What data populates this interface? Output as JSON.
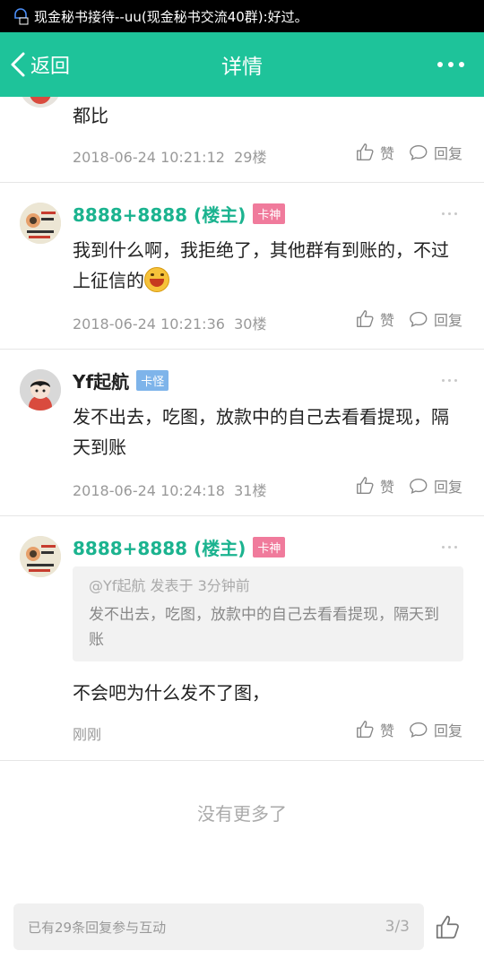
{
  "status_bar": {
    "notification": "现金秘书接待--uu(现金秘书交流40群):好过。"
  },
  "nav": {
    "back_label": "返回",
    "title": "详情"
  },
  "posts": [
    {
      "text": "都比",
      "time": "2018-06-24 10:21:12",
      "floor": "29楼",
      "like_label": "赞",
      "reply_label": "回复"
    },
    {
      "author": "8888+8888 (楼主)",
      "badge": "卡神",
      "text": "我到什么啊，我拒绝了，其他群有到账的，不过上征信的",
      "time": "2018-06-24 10:21:36",
      "floor": "30楼",
      "like_label": "赞",
      "reply_label": "回复"
    },
    {
      "author": "Yf起航",
      "badge": "卡怪",
      "text": "发不出去，吃图，放款中的自己去看看提现，隔天到账",
      "time": "2018-06-24 10:24:18",
      "floor": "31楼",
      "like_label": "赞",
      "reply_label": "回复"
    },
    {
      "author": "8888+8888 (楼主)",
      "badge": "卡神",
      "quote_head": "@Yf起航 发表于 3分钟前",
      "quote_body": "发不出去，吃图，放款中的自己去看看提现，隔天到账",
      "text": "不会吧为什么发不了图，",
      "time": "刚刚",
      "like_label": "赞",
      "reply_label": "回复"
    }
  ],
  "footer_note": "没有更多了",
  "bottom_bar": {
    "placeholder": "已有29条回复参与互动",
    "page": "3/3"
  },
  "colors": {
    "accent": "#1ec39a",
    "author_green": "#1bb38f",
    "badge_pink": "#f07b9c",
    "badge_blue": "#7eb4ea"
  }
}
